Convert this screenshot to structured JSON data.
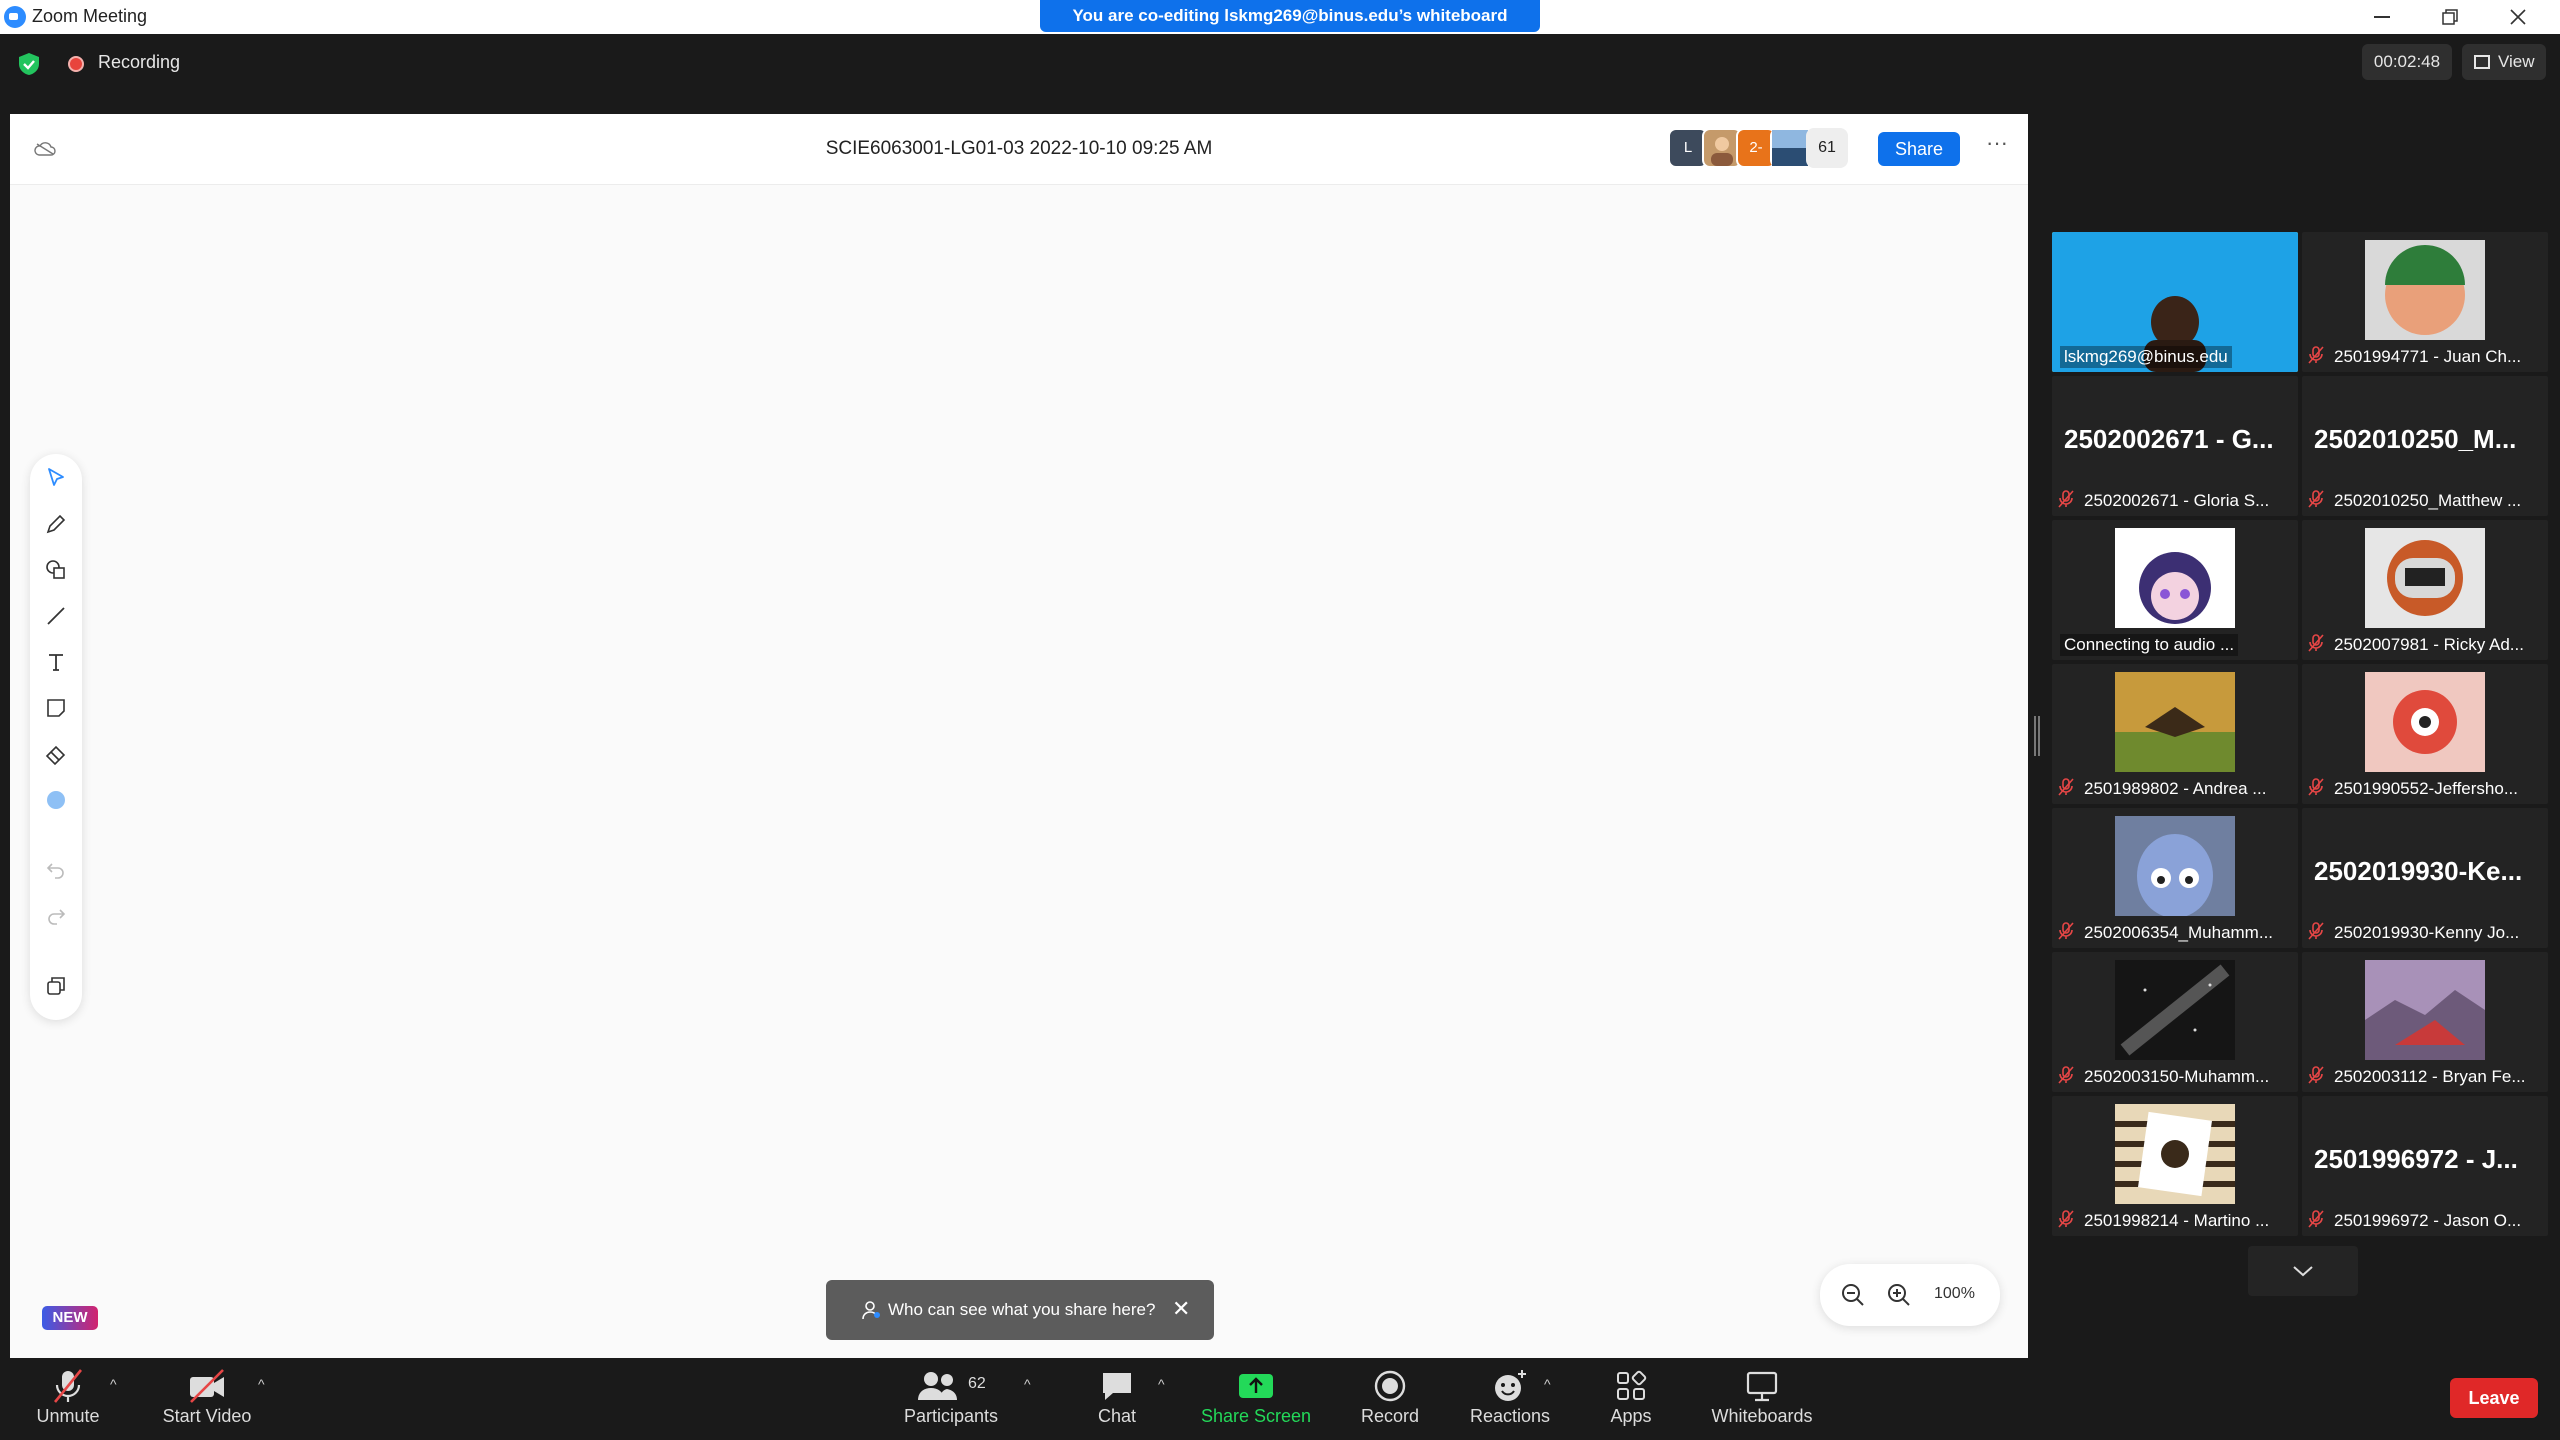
{
  "window": {
    "title": "Zoom Meeting"
  },
  "banner": {
    "text": "You are co-editing lskmg269@binus.edu’s whiteboard"
  },
  "topbar": {
    "recording_label": "Recording",
    "timer": "00:02:48",
    "view_label": "View"
  },
  "whiteboard": {
    "title": "SCIE6063001-LG01-03 2022-10-10 09:25 AM",
    "avatars": [
      "L",
      "",
      "2-",
      ""
    ],
    "participant_count": "61",
    "share_label": "Share",
    "more_label": "···",
    "new_badge": "NEW",
    "toast_text": "Who can see what you share here?",
    "zoom_level": "100%"
  },
  "gallery": {
    "tiles": [
      {
        "name": "lskmg269@binus.edu",
        "big": "",
        "muted": false
      },
      {
        "name": "2501994771 - Juan Ch...",
        "big": "",
        "muted": true
      },
      {
        "name": "2502002671 - Gloria S...",
        "big": "2502002671 - G...",
        "muted": true
      },
      {
        "name": "2502010250_Matthew ...",
        "big": "2502010250_M...",
        "muted": true
      },
      {
        "name": "Connecting to audio ...",
        "big": "",
        "muted": false
      },
      {
        "name": "2502007981 - Ricky Ad...",
        "big": "",
        "muted": true
      },
      {
        "name": "2501989802 - Andrea ...",
        "big": "",
        "muted": true
      },
      {
        "name": "2501990552-Jeffersho...",
        "big": "",
        "muted": true
      },
      {
        "name": "2502006354_Muhamm...",
        "big": "",
        "muted": true
      },
      {
        "name": "2502019930-Kenny Jo...",
        "big": "2502019930-Ke...",
        "muted": true
      },
      {
        "name": "2502003150-Muhamm...",
        "big": "",
        "muted": true
      },
      {
        "name": "2502003112 - Bryan Fe...",
        "big": "",
        "muted": true
      },
      {
        "name": "2501998214 - Martino ...",
        "big": "",
        "muted": true
      },
      {
        "name": "2501996972 - Jason O...",
        "big": "2501996972 - J...",
        "muted": true
      }
    ]
  },
  "bottombar": {
    "unmute": "Unmute",
    "start_video": "Start Video",
    "participants": "Participants",
    "participants_count": "62",
    "chat": "Chat",
    "share_screen": "Share Screen",
    "record": "Record",
    "reactions": "Reactions",
    "apps": "Apps",
    "whiteboards": "Whiteboards",
    "leave": "Leave"
  },
  "colors": {
    "accent": "#0e71eb",
    "leave": "#e02828",
    "share_screen": "#23d959",
    "active_speaker": "#dfe82e"
  }
}
